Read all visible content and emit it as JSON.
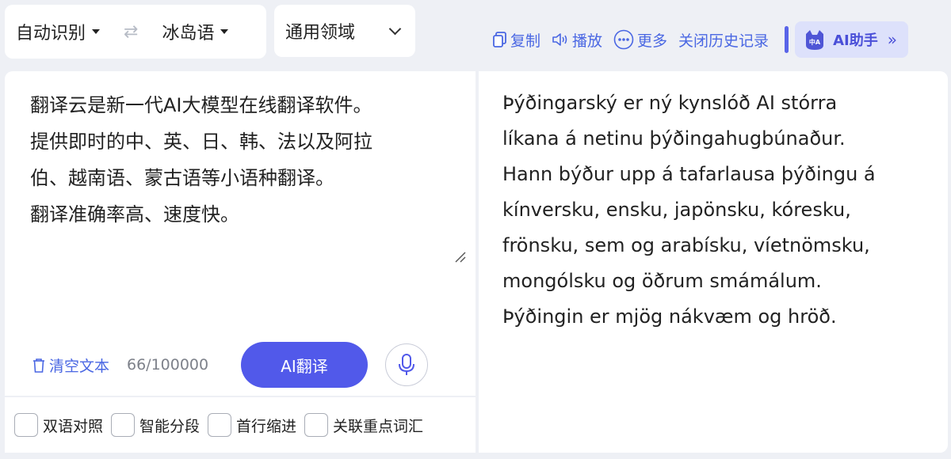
{
  "lang_bar": {
    "source_lang": "自动识别",
    "swap": "⇄",
    "target_lang": "冰岛语"
  },
  "domain_bar": {
    "domain": "通用领域"
  },
  "toolbar": {
    "copy": "复制",
    "play": "播放",
    "more": "更多",
    "close_history": "关闭历史记录",
    "ai_helper": "AI助手",
    "ai_badge": "中A"
  },
  "source": {
    "text": "翻译云是新一代AI大模型在线翻译软件。\n提供即时的中、英、日、韩、法以及阿拉\n伯、越南语、蒙古语等小语种翻译。\n翻译准确率高、速度快。",
    "clear_label": "清空文本",
    "char_count": "66/100000",
    "translate_label": "AI翻译"
  },
  "options": [
    "双语对照",
    "智能分段",
    "首行缩进",
    "关联重点词汇"
  ],
  "target": {
    "text": "Þýðingarský er ný kynslóð AI stórra\nlíkana á netinu þýðingahugbúnaður.\nHann býður upp á tafarlausa þýðingu á\nkínversku, ensku, japönsku, kóresku,\nfrönsku, sem og arabísku, víetnömsku,\nmongólsku og öðrum smámálum.\nÞýðingin er mjög nákvæm og hröð."
  },
  "colors": {
    "accent": "#5159ea",
    "link": "#4a67e3",
    "background": "#eef0f5"
  }
}
